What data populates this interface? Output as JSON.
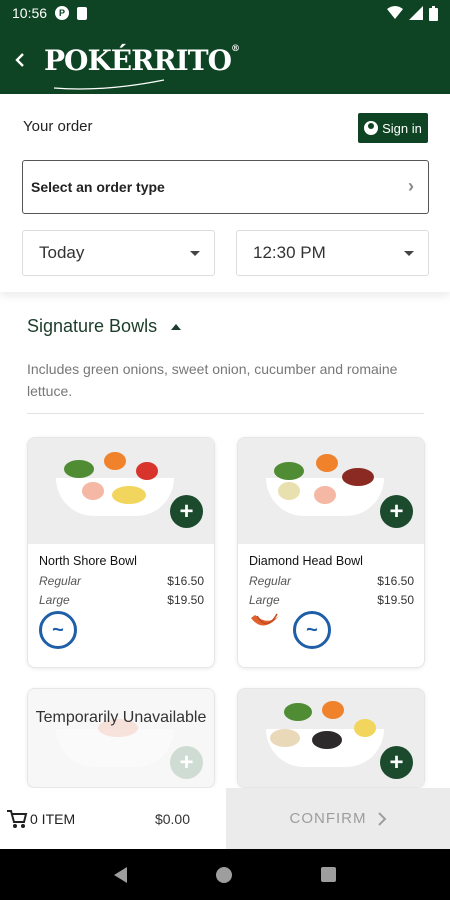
{
  "status_bar": {
    "time": "10:56",
    "notification_letter": "P"
  },
  "header": {
    "logo_text": "POKÉRRITO",
    "logo_mark": "®"
  },
  "order": {
    "title": "Your order",
    "sign_in_label": "Sign in",
    "order_type_placeholder": "Select an order type",
    "date_value": "Today",
    "time_value": "12:30 PM"
  },
  "section": {
    "title": "Signature Bowls",
    "description": "Includes green onions, sweet onion, cucumber and romaine lettuce."
  },
  "products": [
    {
      "name": "North Shore Bowl",
      "sizes": [
        {
          "label": "Regular",
          "price": "$16.50"
        },
        {
          "label": "Large",
          "price": "$19.50"
        }
      ],
      "badges": [
        "fish-icon"
      ]
    },
    {
      "name": "Diamond Head Bowl",
      "sizes": [
        {
          "label": "Regular",
          "price": "$16.50"
        },
        {
          "label": "Large",
          "price": "$19.50"
        }
      ],
      "badges": [
        "spicy-icon",
        "fish-icon"
      ]
    },
    {
      "status_text": "Temporarily Unavailable"
    },
    {}
  ],
  "cart": {
    "count_label": "0 ITEM",
    "total": "$0.00",
    "confirm_label": "CONFIRM"
  },
  "colors": {
    "brand_green": "#0e4423",
    "fish_blue": "#1f5fa8"
  }
}
